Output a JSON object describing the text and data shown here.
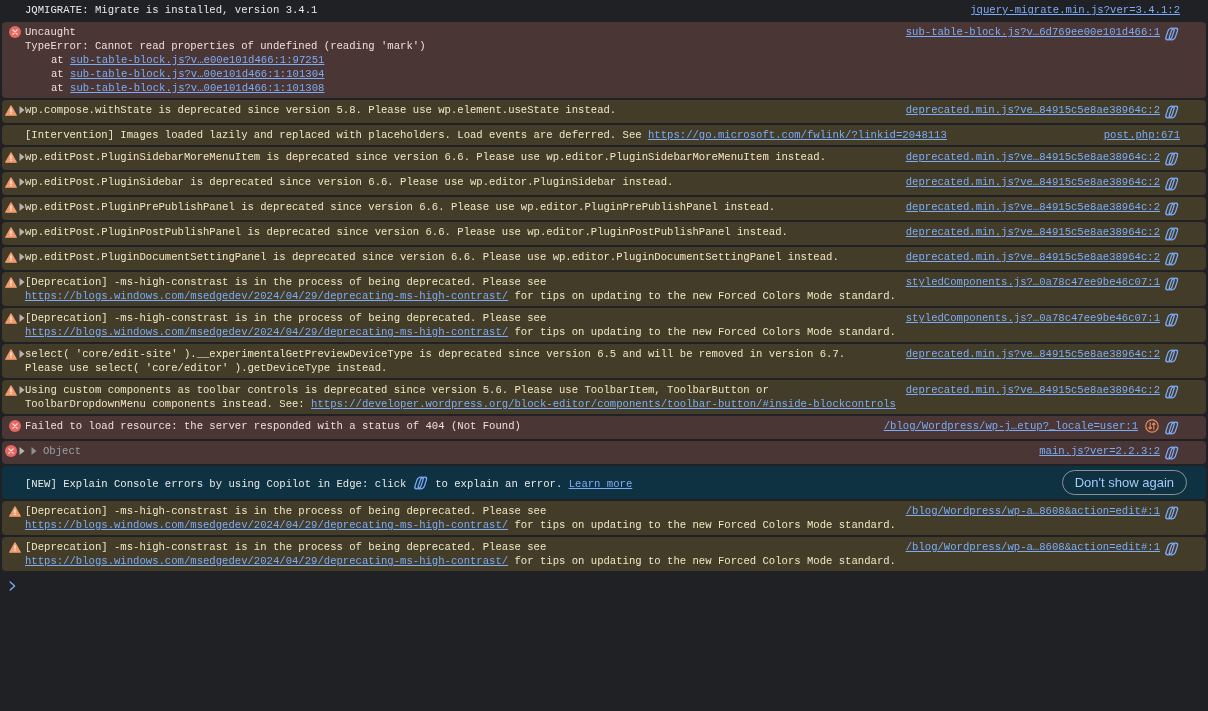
{
  "messages": [
    {
      "kind": "info",
      "text": [
        {
          "kind": "text",
          "text": "JQMIGRATE: Migrate is installed, version 3.4.1"
        }
      ],
      "source": "jquery-migrate.min.js?ver=3.4.1:2",
      "explain_button": false
    },
    {
      "kind": "error",
      "text": [
        {
          "kind": "text",
          "text": "Uncaught"
        }
      ],
      "detail": "TypeError: Cannot read properties of undefined (reading 'mark')",
      "stack": [
        {
          "label": "at",
          "link": "sub-table-block.js?v…e00e101d466:1:97251"
        },
        {
          "label": "at",
          "link": "sub-table-block.js?v…00e101d466:1:101304"
        },
        {
          "label": "at",
          "link": "sub-table-block.js?v…00e101d466:1:101308"
        }
      ],
      "source": "sub-table-block.js?v…6d769ee00e101d466:1",
      "explain_button": true
    },
    {
      "kind": "warning",
      "expanded": false,
      "text": [
        {
          "kind": "text",
          "text": "wp.compose.withState is deprecated since version 5.8. Please use wp.element.useState instead."
        }
      ],
      "source": "deprecated.min.js?ve…84915c5e8ae38964c:2",
      "explain_button": true
    },
    {
      "kind": "intervention",
      "text": [
        {
          "kind": "text",
          "text": "[Intervention] Images loaded lazily and replaced with placeholders. Load events are deferred. See "
        },
        {
          "kind": "link",
          "text": "https://go.microsoft.com/fwlink/?linkid=2048113"
        }
      ],
      "source": "post.php:671",
      "explain_button": false
    },
    {
      "kind": "warning",
      "expanded": false,
      "text": [
        {
          "kind": "text",
          "text": "wp.editPost.PluginSidebarMoreMenuItem is deprecated since version 6.6. Please use wp.editor.PluginSidebarMoreMenuItem instead."
        }
      ],
      "source": "deprecated.min.js?ve…84915c5e8ae38964c:2",
      "explain_button": true
    },
    {
      "kind": "warning",
      "expanded": false,
      "text": [
        {
          "kind": "text",
          "text": "wp.editPost.PluginSidebar is deprecated since version 6.6. Please use wp.editor.PluginSidebar instead."
        }
      ],
      "source": "deprecated.min.js?ve…84915c5e8ae38964c:2",
      "explain_button": true
    },
    {
      "kind": "warning",
      "expanded": false,
      "text": [
        {
          "kind": "text",
          "text": "wp.editPost.PluginPrePublishPanel is deprecated since version 6.6. Please use wp.editor.PluginPrePublishPanel instead."
        }
      ],
      "source": "deprecated.min.js?ve…84915c5e8ae38964c:2",
      "explain_button": true
    },
    {
      "kind": "warning",
      "expanded": false,
      "text": [
        {
          "kind": "text",
          "text": "wp.editPost.PluginPostPublishPanel is deprecated since version 6.6. Please use wp.editor.PluginPostPublishPanel instead."
        }
      ],
      "source": "deprecated.min.js?ve…84915c5e8ae38964c:2",
      "explain_button": true
    },
    {
      "kind": "warning",
      "expanded": false,
      "text": [
        {
          "kind": "text",
          "text": "wp.editPost.PluginDocumentSettingPanel is deprecated since version 6.6. Please use wp.editor.PluginDocumentSettingPanel instead."
        }
      ],
      "source": "deprecated.min.js?ve…84915c5e8ae38964c:2",
      "explain_button": true
    },
    {
      "kind": "warning",
      "expanded": false,
      "text": [
        {
          "kind": "text",
          "text": "[Deprecation] -ms-high-constrast is in the process of being deprecated. Please see\n"
        },
        {
          "kind": "link",
          "text": "https://blogs.windows.com/msedgedev/2024/04/29/deprecating-ms-high-contrast/"
        },
        {
          "kind": "text",
          "text": " for tips on updating to the new Forced Colors Mode standard."
        }
      ],
      "source": "styledComponents.js?…0a78c47ee9be46c07:1",
      "explain_button": true
    },
    {
      "kind": "warning",
      "expanded": false,
      "text": [
        {
          "kind": "text",
          "text": "[Deprecation] -ms-high-constrast is in the process of being deprecated. Please see\n"
        },
        {
          "kind": "link",
          "text": "https://blogs.windows.com/msedgedev/2024/04/29/deprecating-ms-high-contrast/"
        },
        {
          "kind": "text",
          "text": " for tips on updating to the new Forced Colors Mode standard."
        }
      ],
      "source": "styledComponents.js?…0a78c47ee9be46c07:1",
      "explain_button": true
    },
    {
      "kind": "warning",
      "expanded": false,
      "text": [
        {
          "kind": "text",
          "text": "select( 'core/edit-site' ).__experimentalGetPreviewDeviceType is deprecated since version 6.5 and will be removed in version 6.7.\nPlease use select( 'core/editor' ).getDeviceType instead."
        }
      ],
      "source": "deprecated.min.js?ve…84915c5e8ae38964c:2",
      "explain_button": true
    },
    {
      "kind": "warning",
      "expanded": false,
      "text": [
        {
          "kind": "text",
          "text": "Using custom components as toolbar controls is deprecated since version 5.6. Please use ToolbarItem, ToolbarButton or\nToolbarDropdownMenu components instead. See: "
        },
        {
          "kind": "link",
          "text": "https://developer.wordpress.org/block-editor/components/toolbar-button/#inside-blockcontrols"
        }
      ],
      "source": "deprecated.min.js?ve…84915c5e8ae38964c:2",
      "explain_button": true
    },
    {
      "kind": "error",
      "text": [
        {
          "kind": "text",
          "text": "Failed to load resource: the server responded with a status of 404 (Not Found)"
        }
      ],
      "source": "/blog/Wordpress/wp-j…etup?_locale=user:1",
      "network_issue": true,
      "explain_button": true
    },
    {
      "kind": "error",
      "expanded": false,
      "text": [
        {
          "kind": "object",
          "expanded": false,
          "text": "Object"
        }
      ],
      "source": "main.js?ver=2.2.3:2",
      "explain_button": true
    },
    {
      "kind": "banner",
      "text": [
        {
          "kind": "text",
          "text": "[NEW] Explain Console errors by using Copilot in Edge: click "
        },
        {
          "kind": "icon"
        },
        {
          "kind": "text",
          "text": " to explain an error. "
        },
        {
          "kind": "link",
          "text": "Learn more"
        }
      ],
      "button": "Don't show again"
    },
    {
      "kind": "warning",
      "text": [
        {
          "kind": "text",
          "text": "[Deprecation] -ms-high-constrast is in the process of being deprecated. Please see\n"
        },
        {
          "kind": "link",
          "text": "https://blogs.windows.com/msedgedev/2024/04/29/deprecating-ms-high-contrast/"
        },
        {
          "kind": "text",
          "text": " for tips on updating to the new Forced Colors Mode standard."
        }
      ],
      "source": "/blog/Wordpress/wp-a…8608&action=edit#:1",
      "explain_button": true
    },
    {
      "kind": "warning",
      "text": [
        {
          "kind": "text",
          "text": "[Deprecation] -ms-high-constrast is in the process of being deprecated. Please see\n"
        },
        {
          "kind": "link",
          "text": "https://blogs.windows.com/msedgedev/2024/04/29/deprecating-ms-high-contrast/"
        },
        {
          "kind": "text",
          "text": " for tips on updating to the new Forced Colors Mode standard."
        }
      ],
      "source": "/blog/Wordpress/wp-a…8608&action=edit#:1",
      "explain_button": true
    }
  ]
}
